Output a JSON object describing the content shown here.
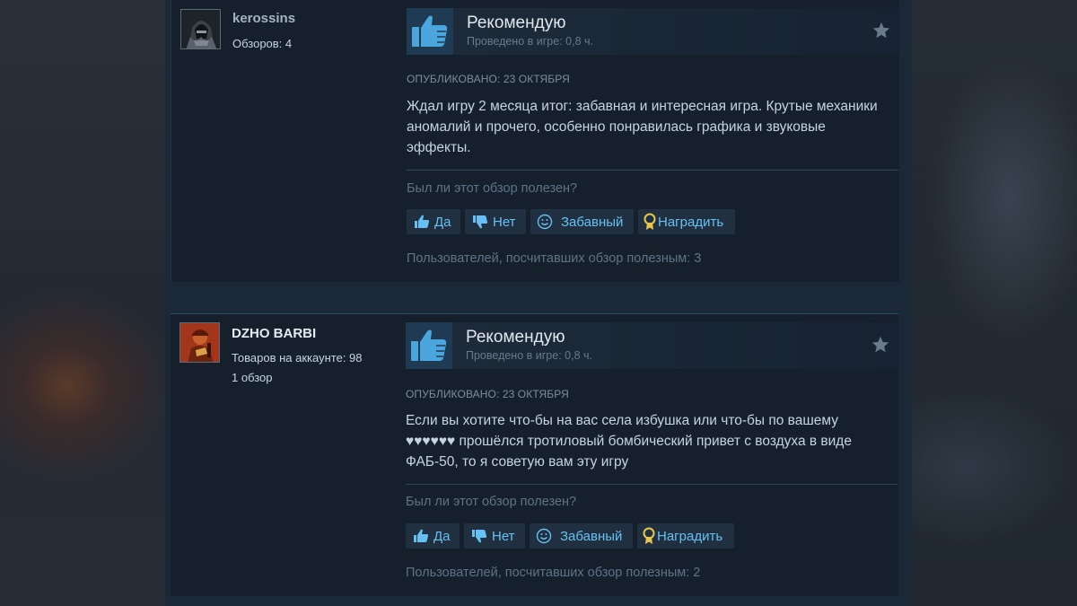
{
  "colors": {
    "accent": "#66c0f4",
    "background": "#1b2838",
    "card": "#16202d",
    "award_gold": "#e8c64a",
    "thumb_blue": "#4ba6de"
  },
  "reviews": [
    {
      "username": "kerossins",
      "user_color": "#a5b3c1",
      "meta": [
        "Обзоров: 4"
      ],
      "recommendation": "Рекомендую",
      "playtime": "Проведено в игре: 0,8 ч.",
      "posted": "ОПУБЛИКОВАНО: 23 ОКТЯБРЯ",
      "text": "Ждал игру 2 месяца итог: забавная и интересная игра. Крутые механики аномалий и прочего, особенно понравилась графика и звуковые эффекты.",
      "helpful_question": "Был ли этот обзор полезен?",
      "buttons": {
        "yes": "Да",
        "no": "Нет",
        "funny": "Забавный",
        "award": "Наградить"
      },
      "helpful_count": "Пользователей, посчитавших обзор полезным: 3",
      "avatar_icon": "hooded-figure-avatar"
    },
    {
      "username": "DZHO BARBI",
      "user_color": "#e4ecf2",
      "meta": [
        "Товаров на аккаунте: 98",
        "1 обзор"
      ],
      "recommendation": "Рекомендую",
      "playtime": "Проведено в игре: 0,8 ч.",
      "posted": "ОПУБЛИКОВАНО: 23 ОКТЯБРЯ",
      "text": "Если вы хотите что-бы на вас села избушка или что-бы по вашему ♥♥♥♥♥♥ прошёлся тротиловый бомбический привет с воздуха в виде ФАБ-50, то я советую вам эту игру",
      "helpful_question": "Был ли этот обзор полезен?",
      "buttons": {
        "yes": "Да",
        "no": "Нет",
        "funny": "Забавный",
        "award": "Наградить"
      },
      "helpful_count": "Пользователей, посчитавших обзор полезным: 2",
      "avatar_icon": "red-character-avatar"
    }
  ]
}
